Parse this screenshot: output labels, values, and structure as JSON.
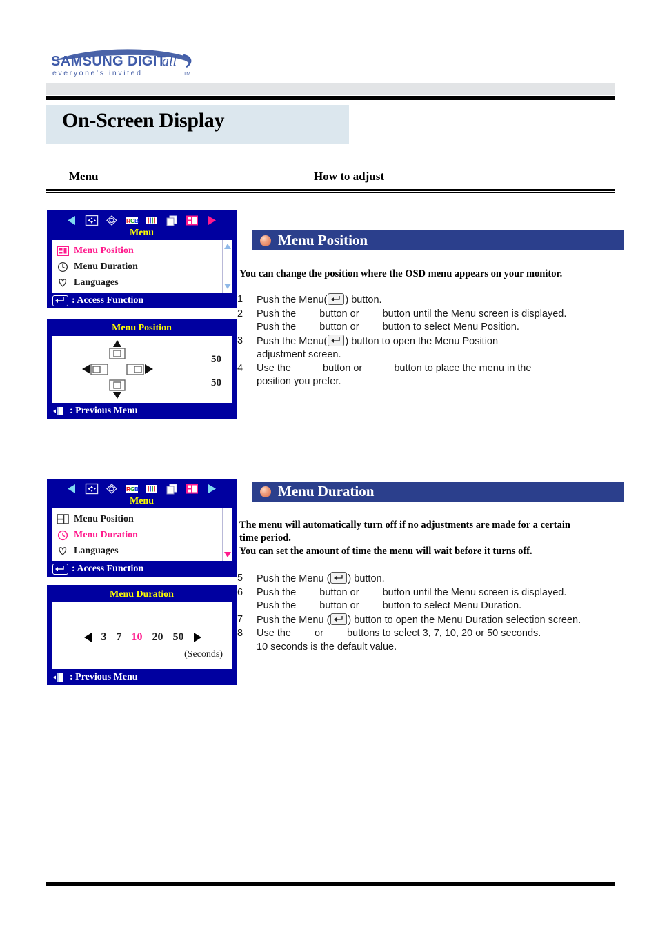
{
  "brand": {
    "logo_main": "SAMSUNG DIGITall",
    "logo_tagline": "everyone's invited",
    "logo_tm": "TM",
    "logo_color": "#3f5ba9"
  },
  "header": {
    "page_title": "On-Screen Display",
    "column_menu": "Menu",
    "column_how": "How to adjust",
    "title_band_color": "#dce7ee"
  },
  "sections": [
    {
      "id": "menu-position",
      "banner": "Menu Position",
      "banner_color": "#2b3f8c",
      "intro": "You can change the position where the OSD menu appears on your monitor.",
      "steps": [
        {
          "n": "1",
          "pre": "Push the Menu(",
          "key": "enter",
          "post": ") button."
        },
        {
          "n": "2",
          "pre": "Push the ",
          "gap": true,
          "post": " button or ",
          "gap2": true,
          "tail": " button until the Menu screen is displayed."
        },
        {
          "n": "",
          "pre": "Push the ",
          "gap": true,
          "post": " button or ",
          "gap2": true,
          "tail": " button to select Menu Position."
        },
        {
          "n": "3",
          "pre": "Push the Menu(",
          "key": "enter",
          "post": ") button to open the Menu Position",
          "tail2": "adjustment screen."
        },
        {
          "n": "4",
          "pre": "Use the ",
          "gap": true,
          "post": " button or ",
          "gap2": true,
          "tail": " button to place the menu in the",
          "tail2": "position you prefer."
        }
      ],
      "osd_menu": {
        "category": "Menu",
        "items": [
          {
            "label": "Menu Position",
            "icon": "menu-position-icon",
            "selected": true
          },
          {
            "label": "Menu Duration",
            "icon": "clock-icon",
            "selected": false
          },
          {
            "label": "Languages",
            "icon": "globe-icon",
            "selected": false
          }
        ],
        "footer": ": Access Function",
        "scroll_up": "up-triangle",
        "scroll_down": "down-triangle",
        "scroll_down_highlight": false
      },
      "osd_adjust": {
        "title": "Menu Position",
        "type": "position-pad",
        "value_h": "50",
        "value_v": "50",
        "footer": ": Previous Menu"
      }
    },
    {
      "id": "menu-duration",
      "banner": "Menu Duration",
      "banner_color": "#2b3f8c",
      "intro_line1": "The menu will automatically turn off if no adjustments are made for a certain",
      "intro_line2": "time period.",
      "intro_line3": "You can set the amount of time the menu will wait before it turns off.",
      "steps": [
        {
          "n": "5",
          "pre": "Push the Menu (",
          "key": "enter",
          "post": ") button."
        },
        {
          "n": "6",
          "pre": "Push the ",
          "gap": true,
          "post": " button or ",
          "gap2": true,
          "tail": " button until the Menu screen is displayed."
        },
        {
          "n": "",
          "pre": "Push the ",
          "gap": true,
          "post": " button or ",
          "gap2": true,
          "tail": " button to select Menu Duration."
        },
        {
          "n": "7",
          "pre": "Push the Menu (",
          "key": "enter",
          "post": ") button to open the Menu Duration selection screen."
        },
        {
          "n": "8",
          "pre": "Use the ",
          "gap": true,
          "post": " or ",
          "gap2": true,
          "tail": " buttons to select 3, 7, 10, 20 or 50 seconds.",
          "tail2": "10 seconds is the default value."
        }
      ],
      "osd_menu": {
        "category": "Menu",
        "items": [
          {
            "label": "Menu Position",
            "icon": "menu-position-icon",
            "selected": false
          },
          {
            "label": "Menu Duration",
            "icon": "clock-icon",
            "selected": true
          },
          {
            "label": "Languages",
            "icon": "globe-icon",
            "selected": false
          }
        ],
        "footer": ": Access Function",
        "scroll_up": "up-triangle",
        "scroll_down": "down-triangle",
        "scroll_down_highlight": true
      },
      "osd_adjust": {
        "title": "Menu Duration",
        "type": "duration-selector",
        "values": [
          "3",
          "7",
          "10",
          "20",
          "50"
        ],
        "selected_value": "10",
        "unit": "(Seconds)",
        "footer": ": Previous Menu"
      }
    }
  ],
  "osd_toolbar_icons": [
    "prev-arrow-icon",
    "image-position-icon",
    "image-size-icon",
    "rgb-color-icon",
    "geometry-icon",
    "osd-overlay-icon",
    "menu-settings-icon",
    "next-arrow-icon"
  ],
  "colors": {
    "osd_background": "#0000a0",
    "osd_highlight": "#ff1a8c",
    "osd_category": "#ffff00",
    "banner": "#2b3f8c",
    "title_band": "#dce7ee",
    "rule": "#000000"
  }
}
